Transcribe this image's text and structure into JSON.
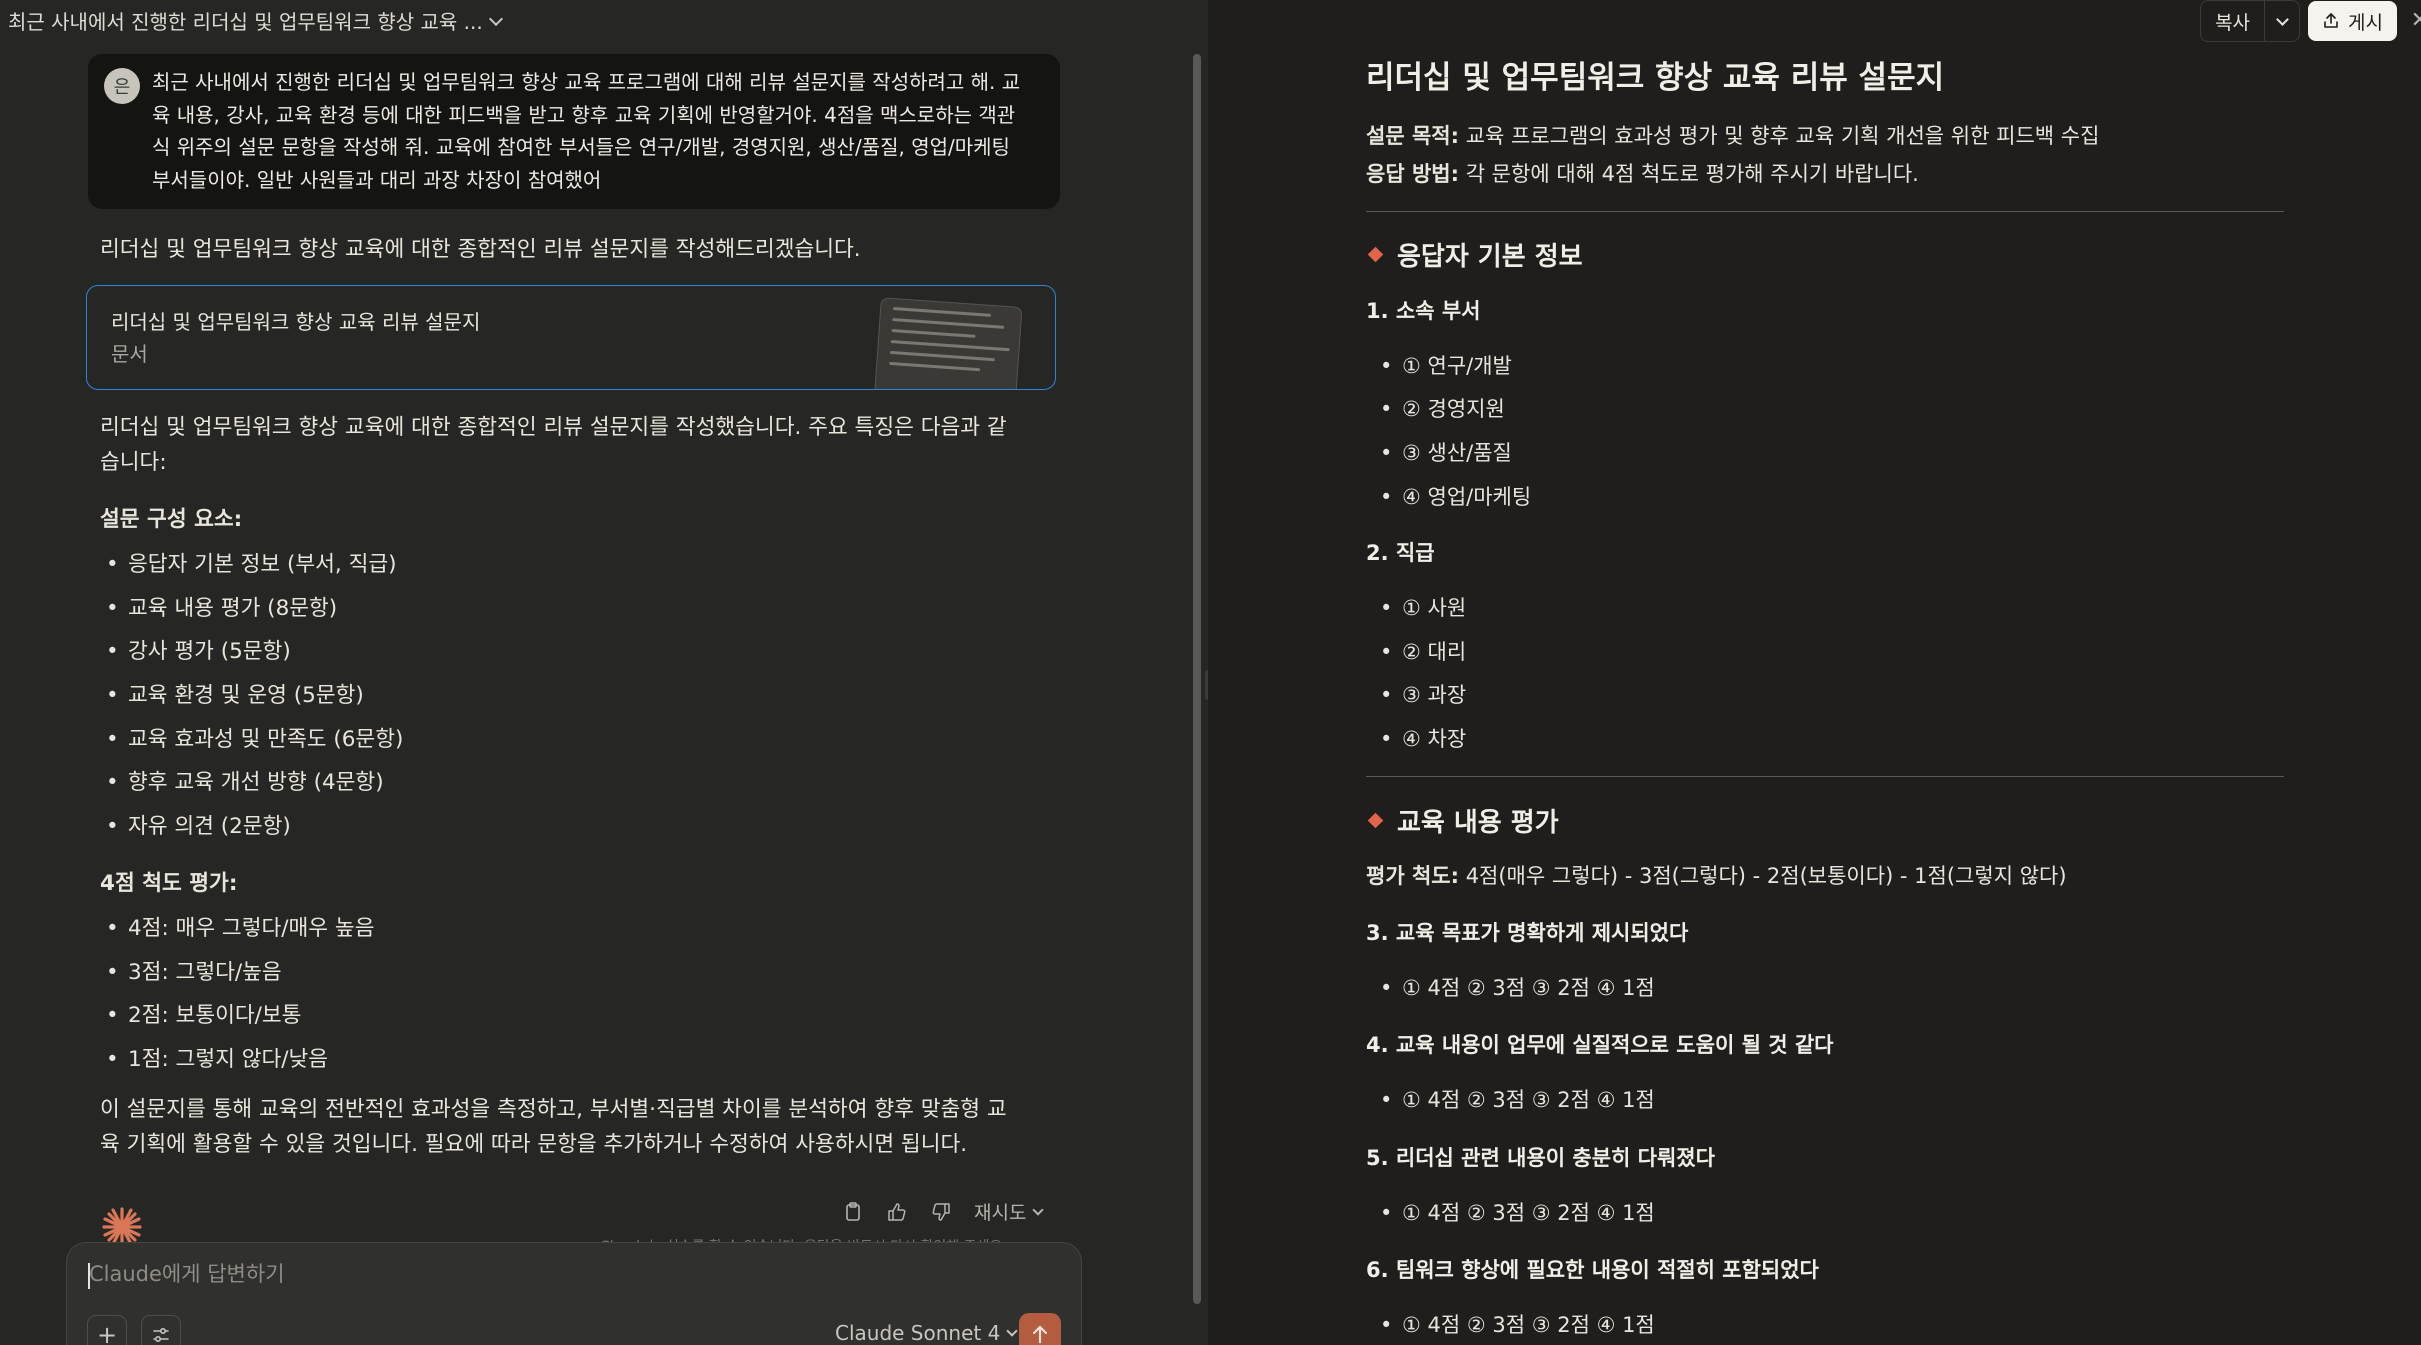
{
  "chat": {
    "title": "최근 사내에서 진행한 리더십 및 업무팀워크 향상 교육 ...",
    "user_initial": "은",
    "user_message": "최근 사내에서 진행한 리더십 및 업무팀워크 향상 교육 프로그램에 대해 리뷰 설문지를 작성하려고 해. 교육 내용, 강사, 교육 환경 등에 대한 피드백을 받고 향후 교육 기획에 반영할거야. 4점을 맥스로하는 객관식 위주의 설문 문항을 작성해 줘. 교육에 참여한 부서들은 연구/개발, 경영지원, 생산/품질, 영업/마케팅 부서들이야. 일반 사원들과 대리 과장 차장이 참여했어",
    "intro": "리더십 및 업무팀워크 향상 교육에 대한 종합적인 리뷰 설문지를 작성해드리겠습니다.",
    "artifact": {
      "title": "리더십 및 업무팀워크 향상 교육 리뷰 설문지",
      "type": "문서"
    },
    "summary": "리더십 및 업무팀워크 향상 교육에 대한 종합적인 리뷰 설문지를 작성했습니다. 주요 특징은 다음과 같습니다:",
    "components_heading": "설문 구성 요소:",
    "components": [
      "응답자 기본 정보 (부서, 직급)",
      "교육 내용 평가 (8문항)",
      "강사 평가 (5문항)",
      "교육 환경 및 운영 (5문항)",
      "교육 효과성 및 만족도 (6문항)",
      "향후 교육 개선 방향 (4문항)",
      "자유 의견 (2문항)"
    ],
    "scale_heading": "4점 척도 평가:",
    "scale": [
      "4점: 매우 그렇다/매우 높음",
      "3점: 그렇다/높음",
      "2점: 보통이다/보통",
      "1점: 그렇지 않다/낮음"
    ],
    "closing": "이 설문지를 통해 교육의 전반적인 효과성을 측정하고, 부서별·직급별 차이를 분석하여 향후 맞춤형 교육 기획에 활용할 수 있을 것입니다. 필요에 따라 문항을 추가하거나 수정하여 사용하시면 됩니다.",
    "retry_label": "재시도",
    "disclaimer": "Claude는 실수를 할 수 있습니다. 응답을 반드시 다시 확인해 주세요."
  },
  "composer": {
    "placeholder": "Claude에게 답변하기",
    "model": "Claude Sonnet 4"
  },
  "toolbar": {
    "copy_label": "복사",
    "publish_label": "게시"
  },
  "doc": {
    "title": "리더십 및 업무팀워크 향상 교육 리뷰 설문지",
    "purpose_label": "설문 목적:",
    "purpose_text": "교육 프로그램의 효과성 평가 및 향후 교육 기획 개선을 위한 피드백 수집",
    "method_label": "응답 방법:",
    "method_text": "각 문항에 대해 4점 척도로 평가해 주시기 바랍니다.",
    "section1": {
      "heading": "응답자 기본 정보",
      "q1": {
        "label": "1. 소속 부서",
        "options": [
          "① 연구/개발",
          "② 경영지원",
          "③ 생산/품질",
          "④ 영업/마케팅"
        ]
      },
      "q2": {
        "label": "2. 직급",
        "options": [
          "① 사원",
          "② 대리",
          "③ 과장",
          "④ 차장"
        ]
      }
    },
    "section2": {
      "heading": "교육 내용 평가",
      "scale_label": "평가 척도:",
      "scale_text": "4점(매우 그렇다) - 3점(그렇다) - 2점(보통이다) - 1점(그렇지 않다)",
      "questions": [
        {
          "label": "3. 교육 목표가 명확하게 제시되었다",
          "options": "① 4점 ② 3점 ③ 2점 ④ 1점"
        },
        {
          "label": "4. 교육 내용이 업무에 실질적으로 도움이 될 것 같다",
          "options": "① 4점 ② 3점 ③ 2점 ④ 1점"
        },
        {
          "label": "5. 리더십 관련 내용이 충분히 다뤄졌다",
          "options": "① 4점 ② 3점 ③ 2점 ④ 1점"
        },
        {
          "label": "6. 팀워크 향상에 필요한 내용이 적절히 포함되었다",
          "options": "① 4점 ② 3점 ③ 2점 ④ 1점"
        }
      ]
    }
  }
}
